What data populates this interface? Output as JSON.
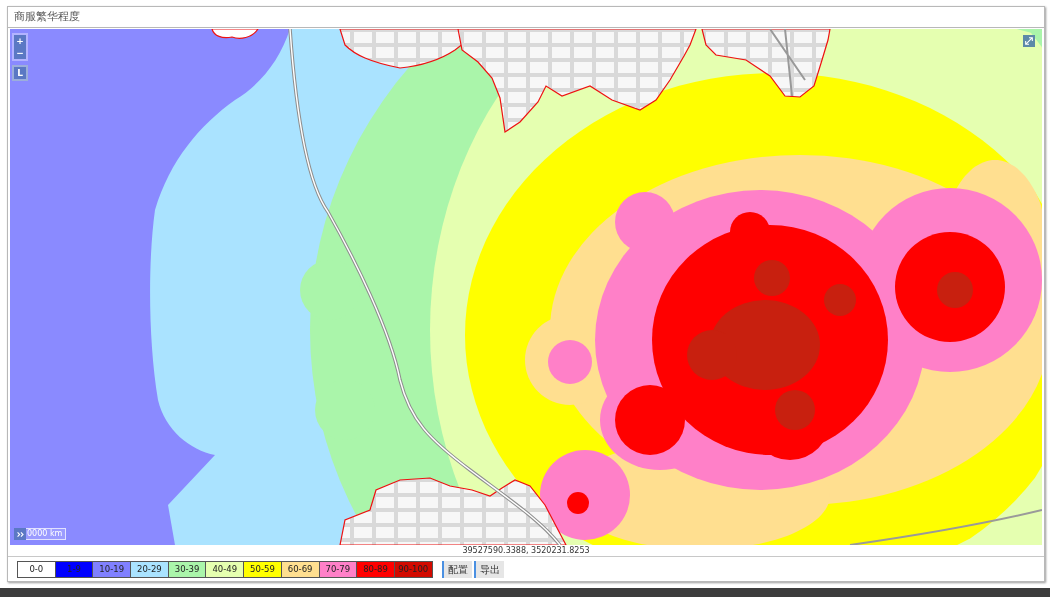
{
  "panel": {
    "title": "商服繁华程度"
  },
  "map": {
    "zoom_in": "+",
    "zoom_out": "−",
    "layer_button": "L",
    "scale": "0000 km"
  },
  "coordinates": "39527590.3388, 3520231.8253",
  "legend": [
    {
      "label": "0-0",
      "color": "#ffffff"
    },
    {
      "label": "1-9",
      "color": "#0000ff"
    },
    {
      "label": "10-19",
      "color": "#8080ff"
    },
    {
      "label": "20-29",
      "color": "#aae3ff"
    },
    {
      "label": "30-39",
      "color": "#aaf5aa"
    },
    {
      "label": "40-49",
      "color": "#e5ffb0"
    },
    {
      "label": "50-59",
      "color": "#ffff00"
    },
    {
      "label": "60-69",
      "color": "#ffdf90"
    },
    {
      "label": "70-79",
      "color": "#ff80c8"
    },
    {
      "label": "80-89",
      "color": "#ff0000"
    },
    {
      "label": "90-100",
      "color": "#d20a00"
    }
  ],
  "buttons": [
    "配置",
    "导出"
  ]
}
